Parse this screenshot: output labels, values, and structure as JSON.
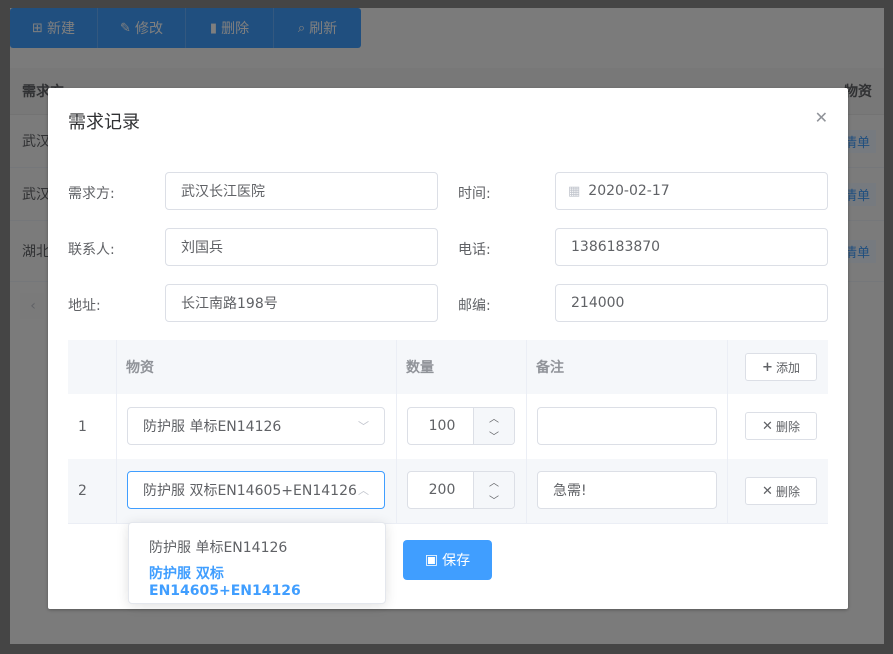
{
  "toolbar": {
    "buttons": [
      {
        "icon": "plus-square-icon",
        "label": "新建"
      },
      {
        "icon": "edit-icon",
        "label": "修改"
      },
      {
        "icon": "trash-icon",
        "label": "删除"
      },
      {
        "icon": "search-icon",
        "label": "刷新"
      }
    ]
  },
  "background_table": {
    "headers": [
      "需求方",
      "物资"
    ],
    "rows": [
      {
        "first": "武汉",
        "link": "清单"
      },
      {
        "first": "武汉",
        "link": "清单"
      },
      {
        "first": "湖北",
        "link": "清单"
      }
    ]
  },
  "dialog": {
    "title": "需求记录",
    "close_icon": "close-icon",
    "form": {
      "requester_label": "需求方:",
      "requester_value": "武汉长江医院",
      "time_label": "时间:",
      "time_value": "2020-02-17",
      "contact_label": "联系人:",
      "contact_value": "刘国兵",
      "phone_label": "电话:",
      "phone_value": "1386183870",
      "address_label": "地址:",
      "address_value": "长江南路198号",
      "zip_label": "邮编:",
      "zip_value": "214000"
    },
    "items_table": {
      "headers": {
        "material": "物资",
        "quantity": "数量",
        "remark": "备注"
      },
      "add_button": "添加",
      "rows": [
        {
          "index": "1",
          "material": "防护服 单标EN14126",
          "quantity": "100",
          "remark": "",
          "delete_label": "删除"
        },
        {
          "index": "2",
          "material": "防护服 双标EN14605+EN14126",
          "quantity": "200",
          "remark": "急需!",
          "delete_label": "删除"
        }
      ]
    },
    "dropdown_options": [
      {
        "label": "防护服 单标EN14126",
        "selected": false
      },
      {
        "label": "防护服 双标EN14605+EN14126",
        "selected": true
      }
    ],
    "save_button": "保存"
  },
  "colors": {
    "primary": "#409eff",
    "mask": "rgba(0,0,0,0.5)"
  }
}
